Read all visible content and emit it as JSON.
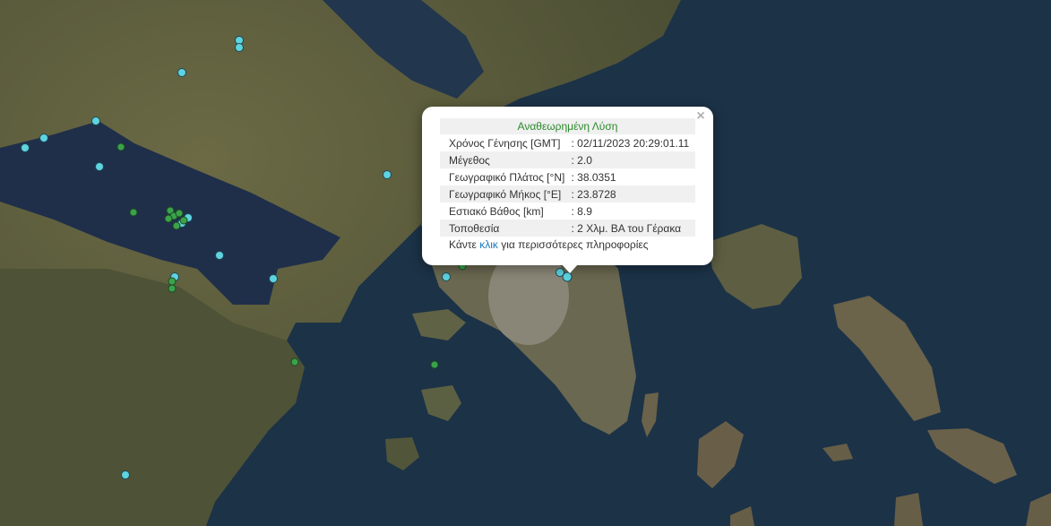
{
  "popup": {
    "title": "Αναθεωρημένη Λύση",
    "close_label": "×",
    "rows": [
      {
        "label": "Χρόνος Γένησης [GMT]",
        "value": ": 02/11/2023 20:29:01.11"
      },
      {
        "label": "Μέγεθος",
        "value": ": 2.0"
      },
      {
        "label": "Γεωγραφικό Πλάτος [°N]",
        "value": ": 38.0351"
      },
      {
        "label": "Γεωγραφικό Μήκος [°E]",
        "value": ": 23.8728"
      },
      {
        "label": "Εστιακό Βάθος [km]",
        "value": ": 8.9"
      },
      {
        "label": "Τοποθεσία",
        "value": ": 2 Χλμ. ΒΑ του Γέρακα"
      }
    ],
    "more_prefix": "Κάντε ",
    "more_link": "κλικ",
    "more_suffix": " για περισσότερες πληροφορίες"
  },
  "colors": {
    "sea": "#1c3247",
    "land": "#5a5a3c",
    "marker_cyan": "#5fd3e0",
    "marker_green": "#3aa34a",
    "title_green": "#2a8a2a",
    "link_blue": "#1a7abf"
  },
  "markers": {
    "cyan_count": 17,
    "green_count": 13
  }
}
